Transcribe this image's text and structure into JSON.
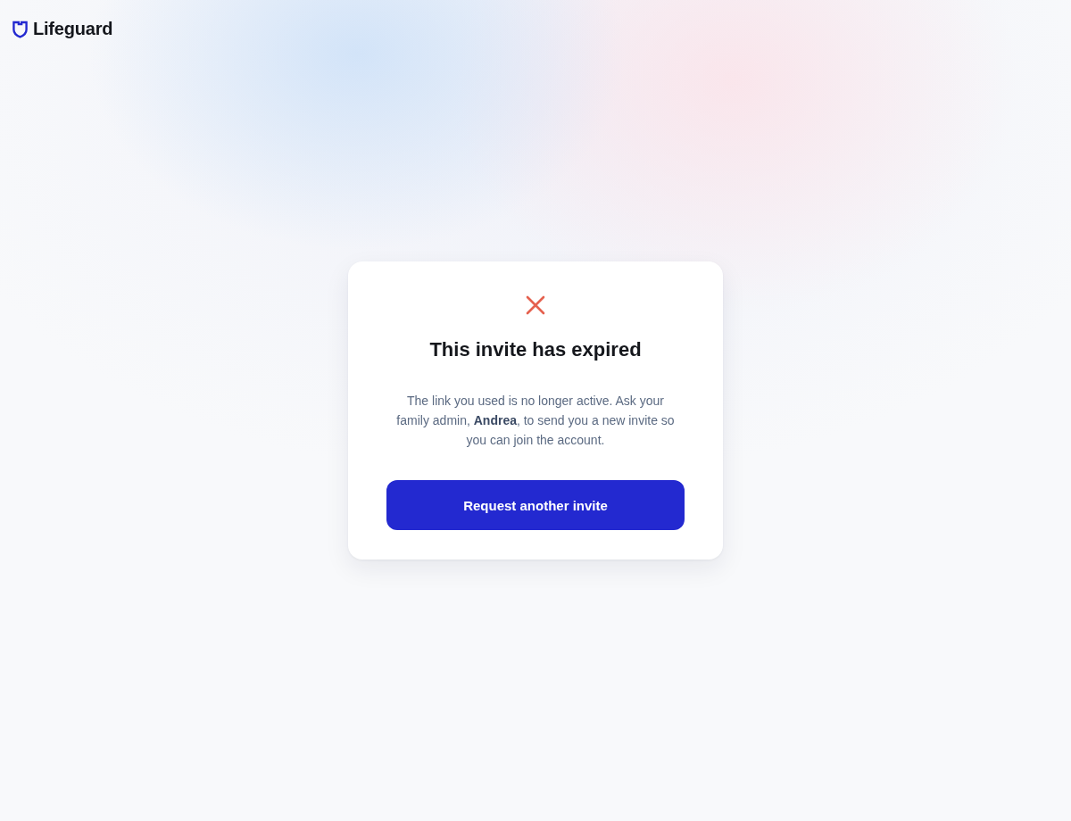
{
  "brand": {
    "name": "Lifeguard"
  },
  "dialog": {
    "title": "This invite has expired",
    "message": "The link you used is no longer active. Ask your family admin, **Andrea**, to send you a new invite so you can join the account.",
    "button": {
      "label": "Request another invite"
    }
  }
}
